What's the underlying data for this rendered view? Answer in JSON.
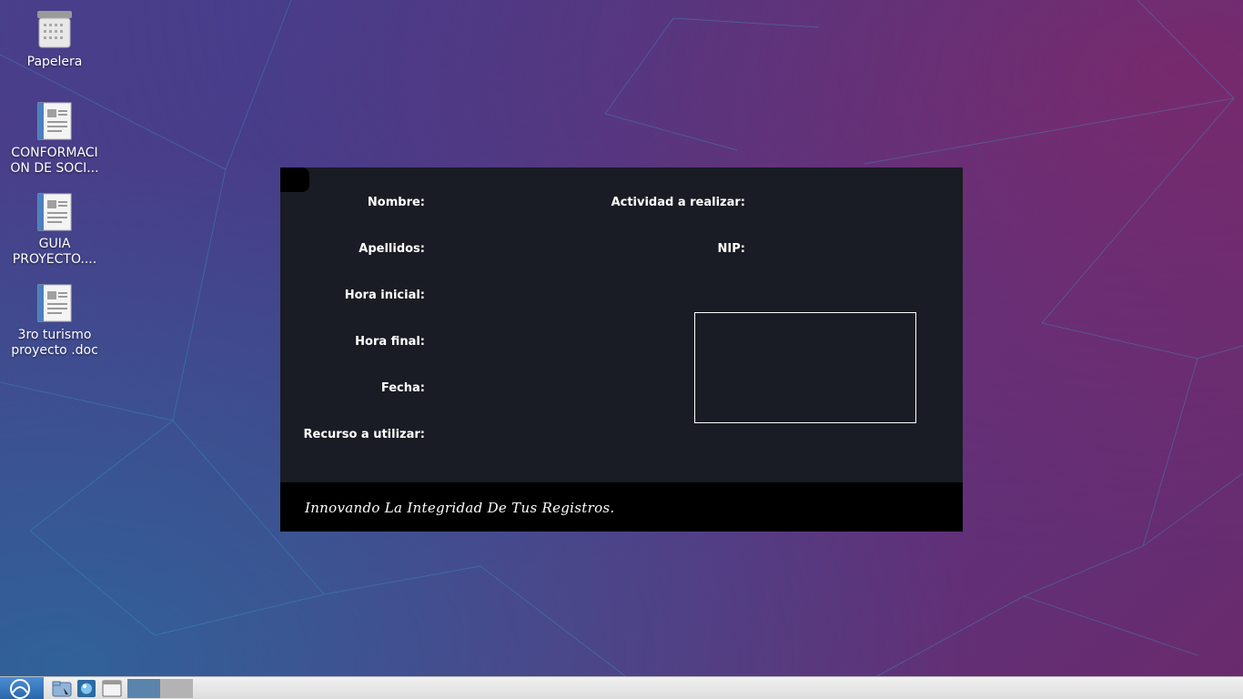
{
  "desktop": {
    "icons": [
      {
        "label": "Papelera",
        "icon": "trash-icon"
      },
      {
        "label": "CONFORMACI\nON DE SOCI...",
        "icon": "document-icon"
      },
      {
        "label": "GUIA\nPROYECTO....",
        "icon": "document-icon"
      },
      {
        "label": "3ro turismo\nproyecto .doc",
        "icon": "document-icon"
      }
    ]
  },
  "form": {
    "labels": {
      "nombre": "Nombre:",
      "apellidos": "Apellidos:",
      "hora_inicial": "Hora inicial:",
      "hora_final": "Hora final:",
      "fecha": "Fecha:",
      "recurso": "Recurso a utilizar:",
      "actividad": "Actividad a realizar:",
      "nip": "NIP:"
    },
    "slogan": "Innovando La Integridad De Tus Registros."
  },
  "colors": {
    "window_bg": "#191c24",
    "footer_bg": "#000000",
    "label_text": "#ffffff"
  }
}
